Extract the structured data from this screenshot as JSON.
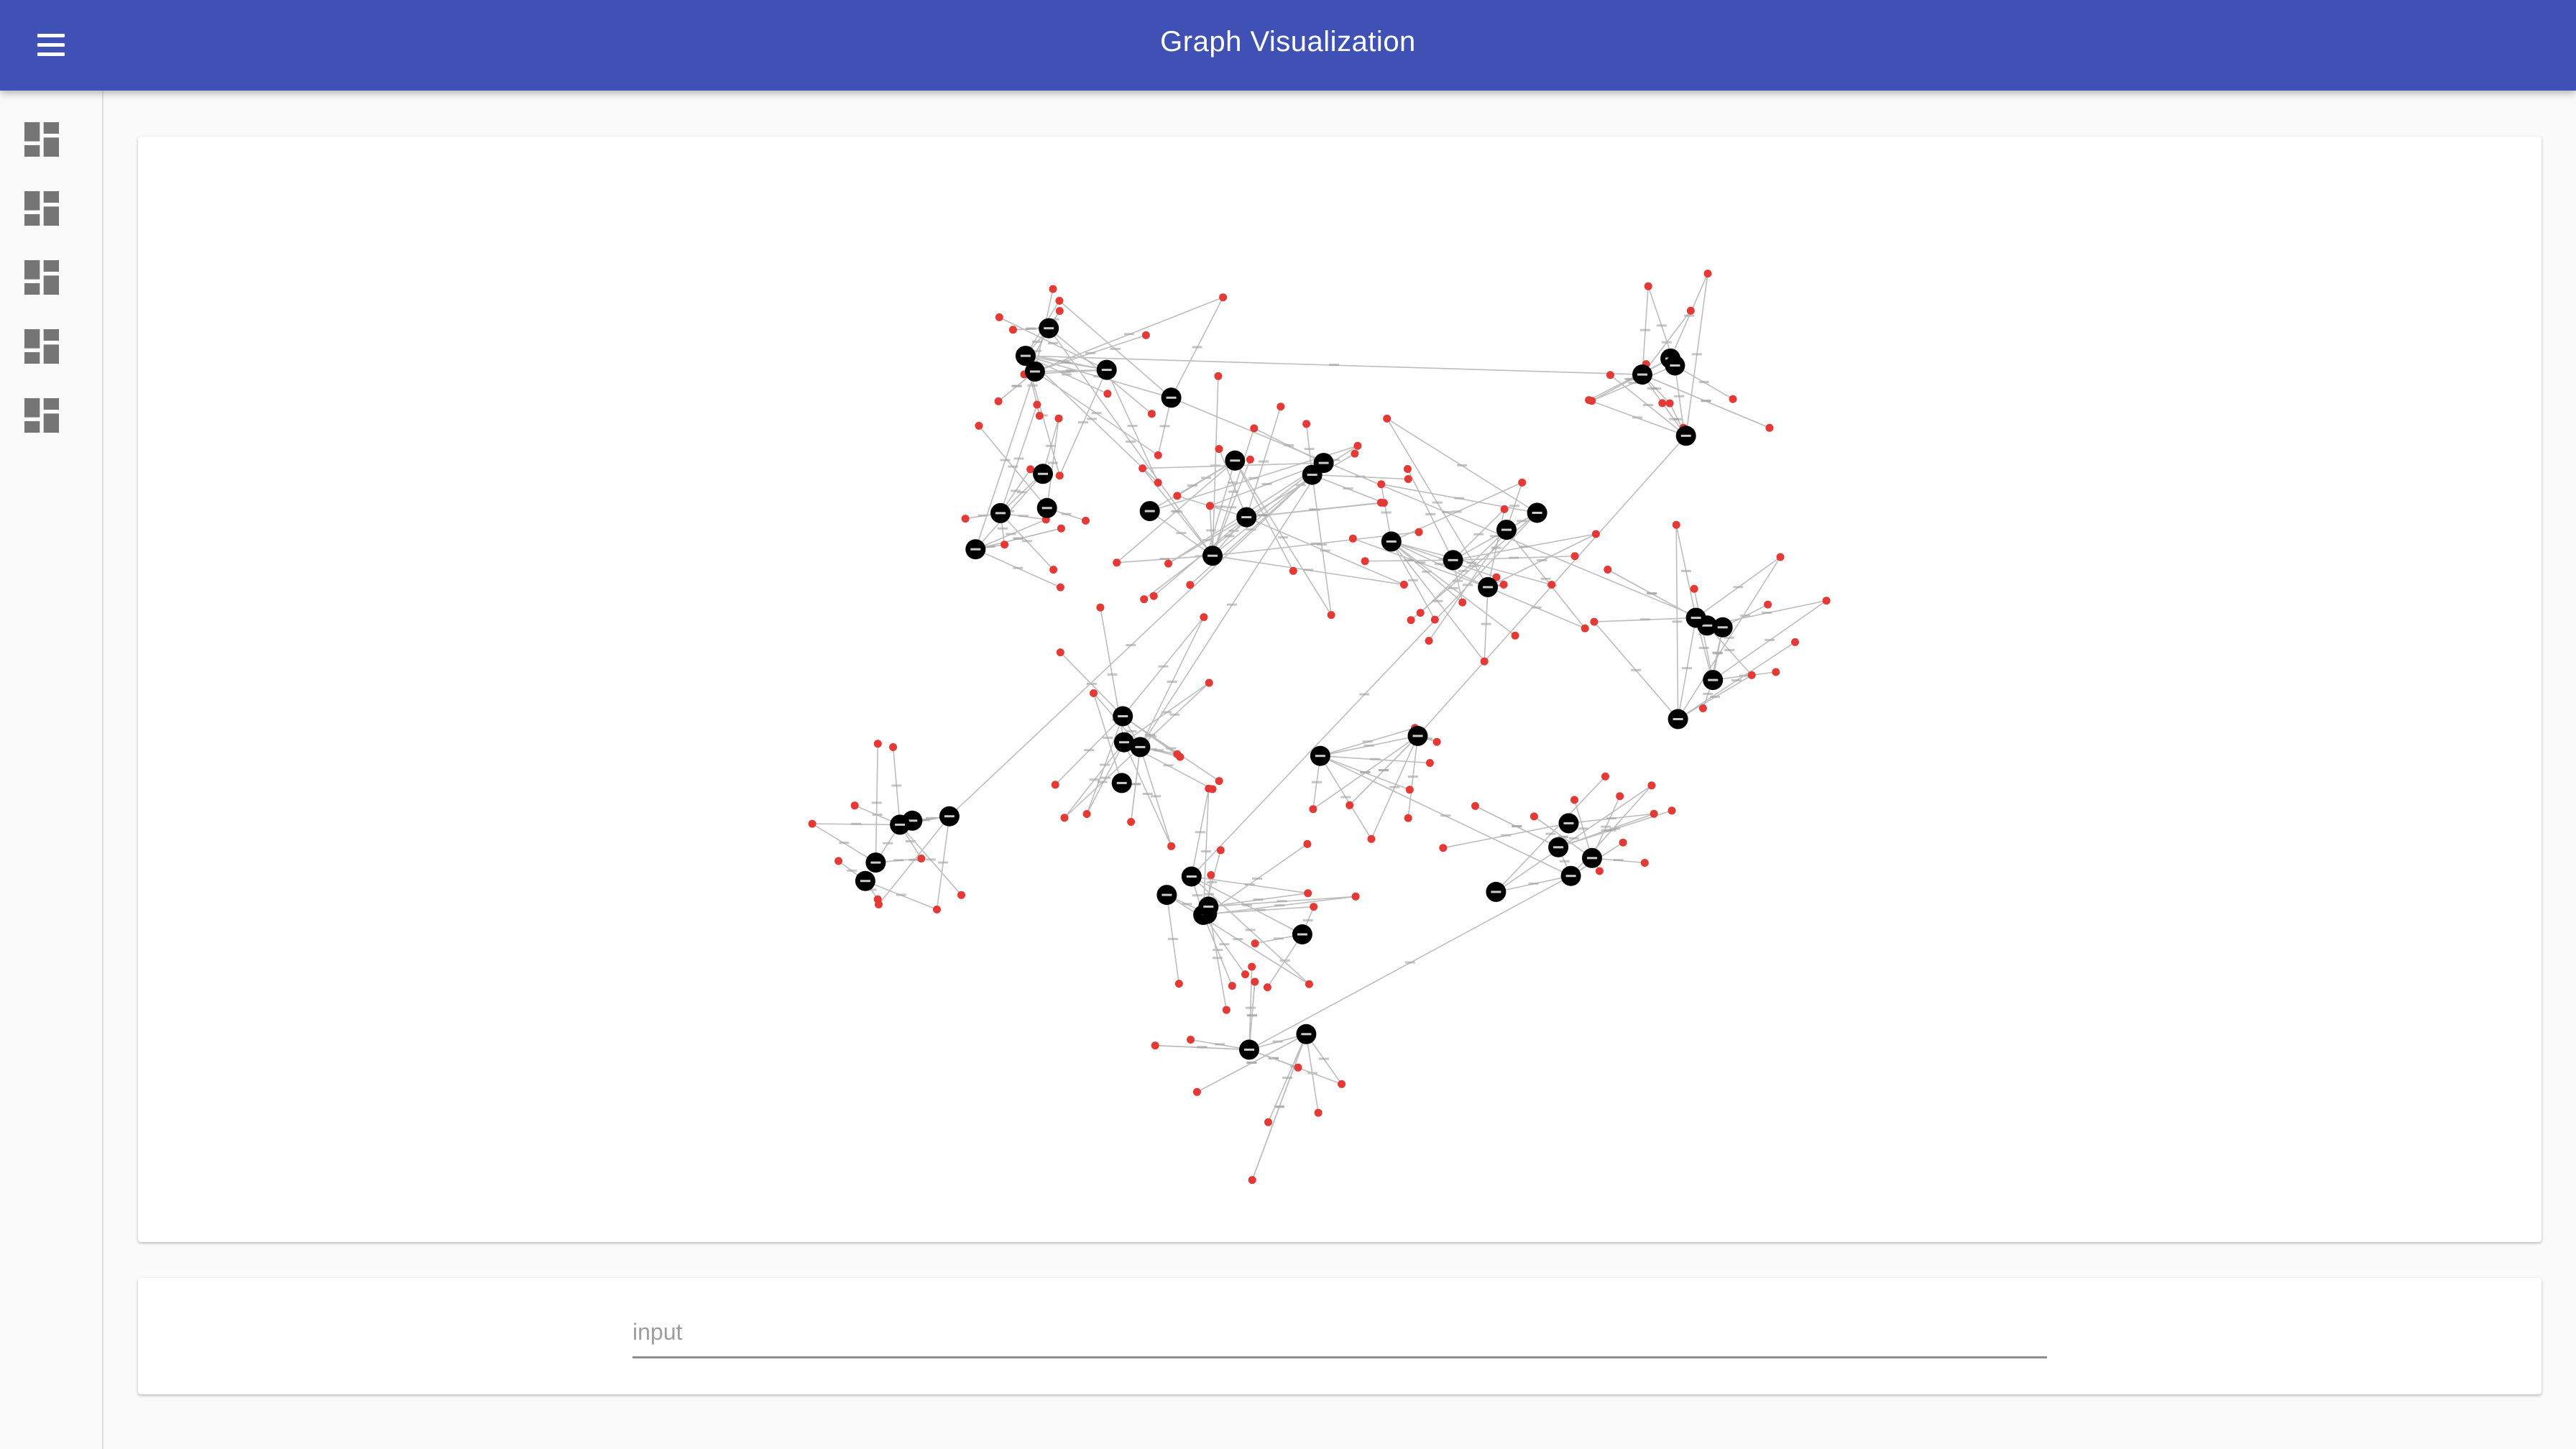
{
  "app": {
    "title": "Graph Visualization",
    "primary_color": "#3f51b5"
  },
  "header": {
    "menu_icon": "menu-icon"
  },
  "sidebar": {
    "items": [
      {
        "icon": "dashboard-icon"
      },
      {
        "icon": "dashboard-icon"
      },
      {
        "icon": "dashboard-icon"
      },
      {
        "icon": "dashboard-icon"
      },
      {
        "icon": "dashboard-icon"
      }
    ]
  },
  "graph": {
    "hub_color": "#000000",
    "leaf_color": "#e53935",
    "edge_color": "#bdbdbd"
  },
  "search": {
    "placeholder": "input",
    "value": ""
  }
}
